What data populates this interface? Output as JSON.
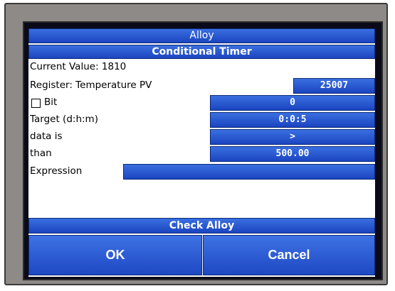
{
  "header": {
    "title": "Alloy",
    "subtitle": "Conditional Timer"
  },
  "current_value": "Current Value: 1810",
  "register": {
    "label": "Register: Temperature PV",
    "value": "25007"
  },
  "bit": {
    "label": "Bit",
    "checked": false,
    "value": "0"
  },
  "target": {
    "label": "Target (d:h:m)",
    "value": "0:0:5"
  },
  "data_is": {
    "label": "data is",
    "value": ">"
  },
  "than": {
    "label": "than",
    "value": "500.00"
  },
  "expression": {
    "label": "Expression",
    "value": ""
  },
  "check_alloy_label": "Check Alloy",
  "ok_label": "OK",
  "cancel_label": "Cancel",
  "colors": {
    "button_blue": "#1b45c0",
    "bezel_gray": "#8e8a88",
    "screen_frame": "#0a0a18"
  }
}
